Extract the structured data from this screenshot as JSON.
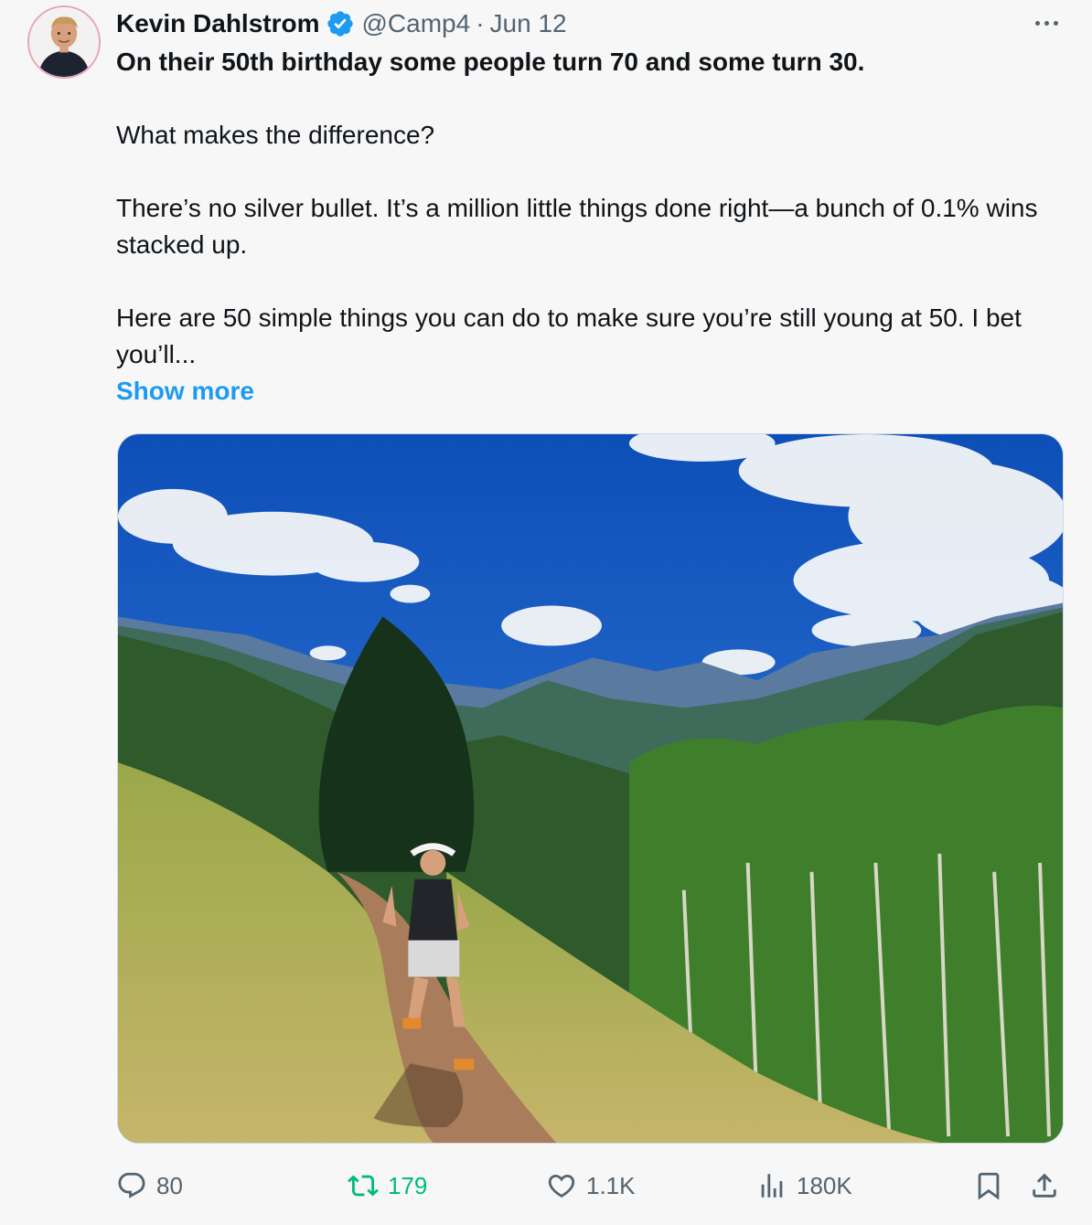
{
  "author": {
    "name": "Kevin Dahlstrom",
    "handle": "@Camp4",
    "separator": "·",
    "date": "Jun 12",
    "avatar_icon": "person-avatar",
    "verified_icon": "verified-badge-icon"
  },
  "tweet": {
    "lead": "On their 50th birthday some people turn 70 and some turn 30.",
    "paragraph_2": "What makes the difference?",
    "paragraph_3": "There’s no silver bullet. It’s a million little things done right—a bunch of 0.1% wins stacked up.",
    "paragraph_4": "Here are 50 simple things you can do to make sure you’re still young at 50. I bet you’ll...",
    "show_more": "Show more"
  },
  "media": {
    "type": "photo",
    "description_icon": "mountain-trail-photo"
  },
  "actions": {
    "replies": "80",
    "retweets": "179",
    "likes": "1.1K",
    "views": "180K"
  },
  "colors": {
    "accent": "#1d9bf0",
    "retweet": "#00ba7c",
    "muted": "#536471",
    "text": "#0f1419"
  }
}
